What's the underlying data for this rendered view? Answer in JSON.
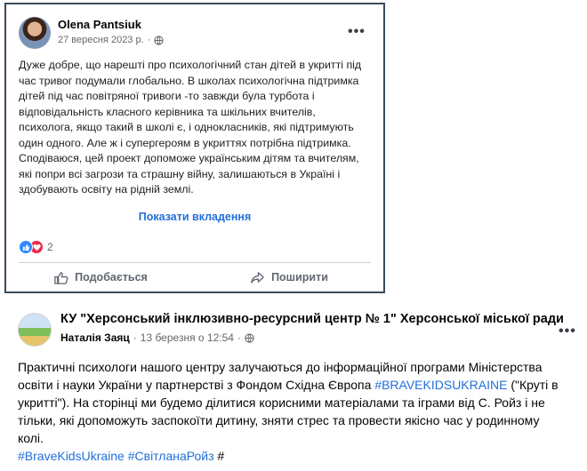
{
  "post1": {
    "author": "Olena Pantsiuk",
    "date": "27 вересня 2023 р.",
    "separator": "·",
    "more": "•••",
    "body_lines": [
      "Дуже добре, що нарешті про психологічний стан дітей в укритті  під",
      "час тривог подумали глобально. В школах психологічна підтримка",
      "дітей під час повітряної тривоги -то завжди була турбота і",
      "відповідальність класного керівника та шкільних вчителів,",
      "психолога, якщо такий в школі є, і однокласників, які підтримують",
      "один одного.  Але ж і супергероям в укриттях потрібна підтримка.",
      "Сподіваюся, цей проект допоможе українським дітям та вчителям,",
      "які попри всі загрози та страшну війну, залишаються в Україні і",
      "здобувають освіту на рідній землі."
    ],
    "show_attachments": "Показати вкладення",
    "reaction_count": "2",
    "like_label": "Подобається",
    "share_label": "Поширити",
    "colors": {
      "accent": "#216fdb",
      "like": "#2d88ff",
      "love": "#f0284a"
    }
  },
  "post2": {
    "org": "КУ \"Херсонський інклюзивно-ресурсний центр № 1\" Херсонської міської ради",
    "author": "Наталія Заяц",
    "date": "13 березня о 12:54",
    "separator": "·",
    "more": "•••",
    "body_lines": [
      [
        "Практичні психологи нашого центру залучаються до інформаційної програми Міністерства"
      ],
      [
        "освіти і науки України  у партнерстві з Фондом Східна Європа ",
        "#BRAVEKIDSUKRAINE",
        " (\"Круті в"
      ],
      [
        "укритті\").  На сторінці ми будемо ділитися  корисними матеріалами та іграми  від С. Ройз і не"
      ],
      [
        "тільки,  які допоможуть заспокоїти дитину, зняти стрес та провести якісно час у родинному"
      ],
      [
        "колі."
      ]
    ],
    "hashtag1": "#BraveKidsUkraine",
    "hashtag2": "#СвітланаРойз",
    "hashtag3": "#"
  }
}
